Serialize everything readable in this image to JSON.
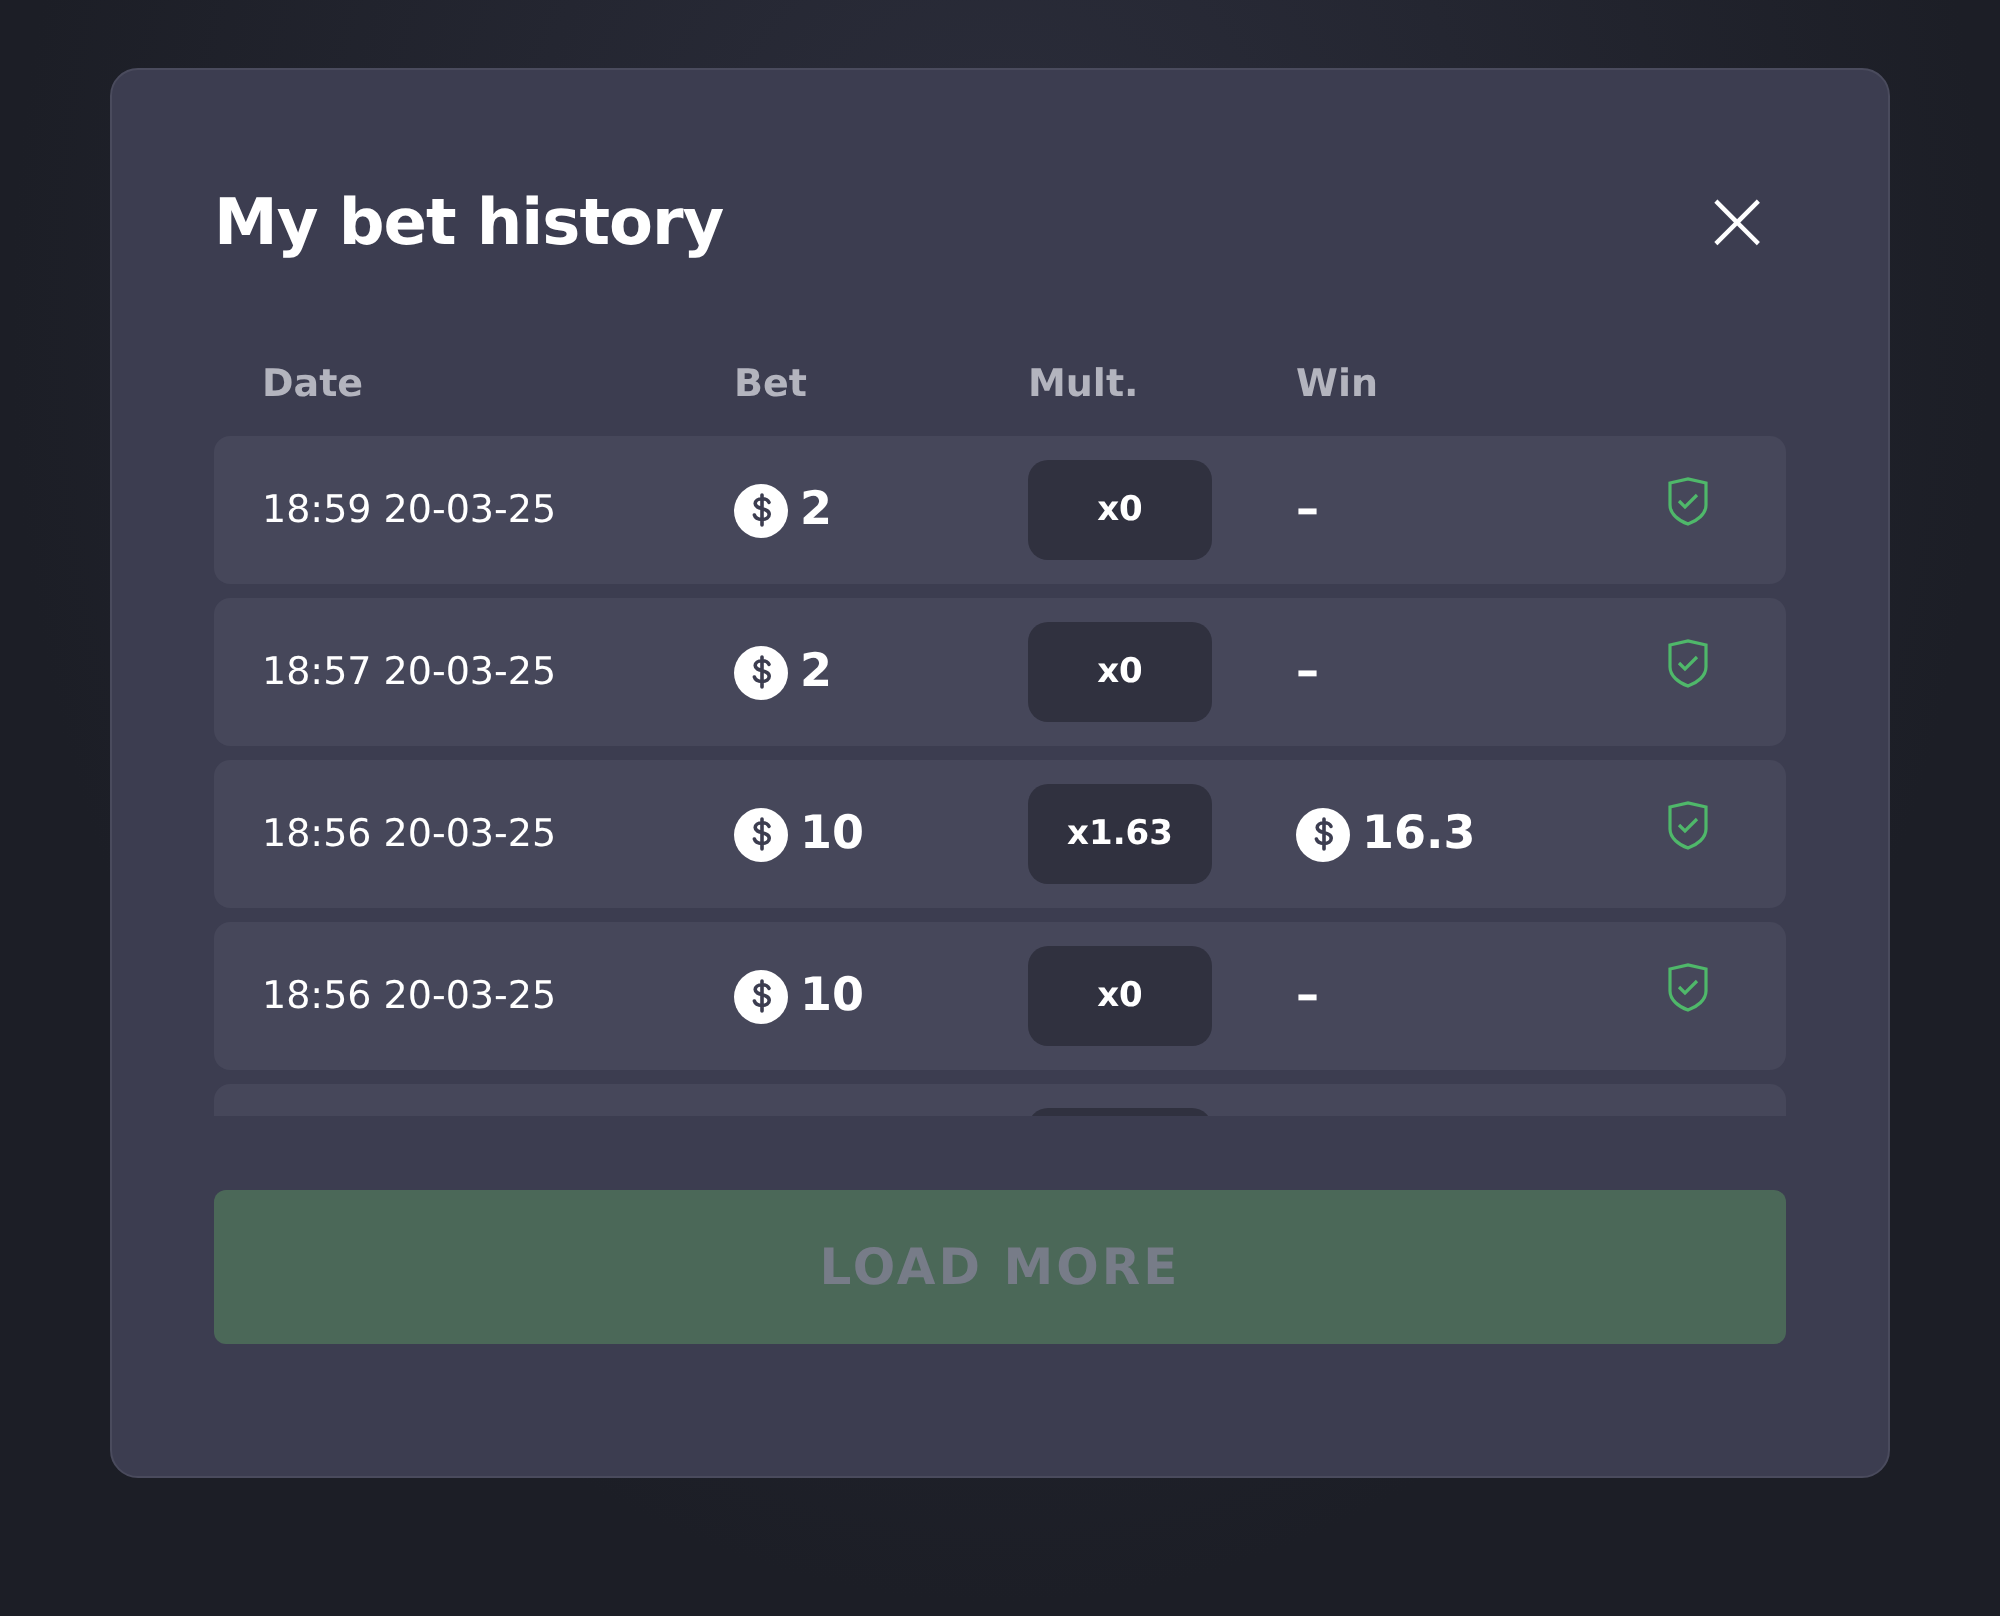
{
  "dialog": {
    "title": "My bet history",
    "close": "×"
  },
  "table": {
    "columns": [
      "Date",
      "Bet",
      "Mult.",
      "Win"
    ],
    "rows": [
      {
        "kind": "full",
        "date": "18:59 20-03-25",
        "bet": "2",
        "mult": "x0",
        "win": "–",
        "win_currency": false
      },
      {
        "kind": "full",
        "date": "18:57 20-03-25",
        "bet": "2",
        "mult": "x0",
        "win": "–",
        "win_currency": false
      },
      {
        "kind": "full",
        "date": "18:56 20-03-25",
        "bet": "10",
        "mult": "x1.63",
        "win": "16.3",
        "win_currency": true
      },
      {
        "kind": "full",
        "date": "18:56 20-03-25",
        "bet": "10",
        "mult": "x0",
        "win": "–",
        "win_currency": false
      },
      {
        "kind": "cut"
      }
    ]
  },
  "load_more": {
    "label": "LOAD MORE",
    "disabled": true
  }
}
